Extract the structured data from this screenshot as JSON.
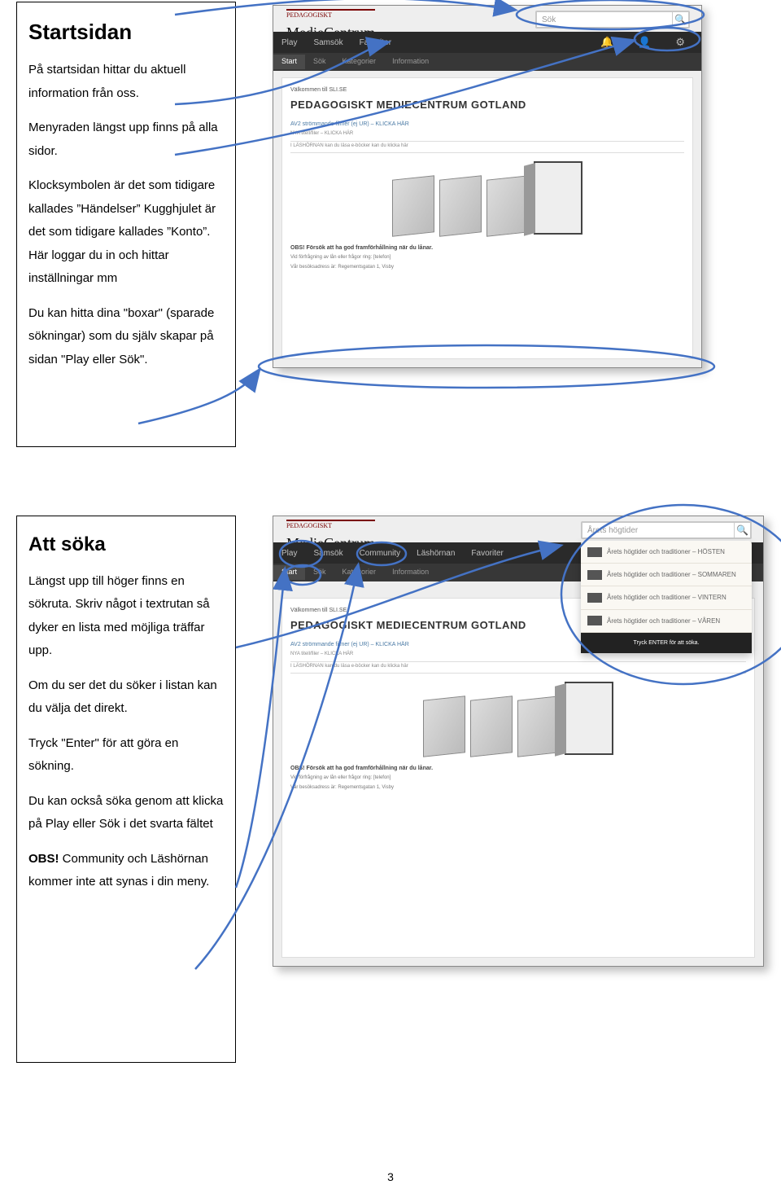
{
  "pageNumber": "3",
  "box1": {
    "title": "Startsidan",
    "p1": "På startsidan hittar du aktuell information från oss.",
    "p2": "Menyraden längst upp finns på alla sidor.",
    "p3": "Klocksymbolen är det som tidigare kallades ”Händelser” Kugghjulet är det som tidigare kallades ”Konto”. Här loggar du in och hittar inställningar mm",
    "p4": "Du kan hitta dina \"boxar\" (sparade sökningar) som du själv skapar på sidan \"Play eller Sök\"."
  },
  "box2": {
    "title": "Att söka",
    "p1": "Längst upp till höger finns en sökruta. Skriv något i textrutan så dyker en lista med möjliga träffar upp.",
    "p2": "Om du ser det du söker i listan kan du välja det direkt.",
    "p3": "Tryck \"Enter\" för att göra en sökning.",
    "p4": "Du kan också söka genom att klicka på Play eller Sök i det svarta fältet",
    "p5a": "OBS!",
    "p5b": " Community och Läshörnan kommer inte att synas i din meny."
  },
  "shot1": {
    "logo_brand": "PEDAGOGISKT",
    "logo_script": "MedieCentrum",
    "search_placeholder": "Sök",
    "nav": {
      "play": "Play",
      "samsok": "Samsök",
      "favoriter": "Favoriter"
    },
    "icon_bell": "🔔",
    "icon_user": "👤",
    "icon_gear": "⚙",
    "subnav": {
      "start": "Start",
      "sok": "Sök",
      "kategorier": "Kategorier",
      "info": "Information"
    },
    "welcome_small": "Välkommen till SLI.SE",
    "big": "PEDAGOGISKT MEDIECENTRUM GOTLAND",
    "link1": "AV2 strömmande filmer (ej UR) – KLICKA HÄR",
    "tiny1": "NYA titell/filer – KLICKA HÄR",
    "tiny2": "I LÄSHÖRNAN kan du läsa e-böcker kan du klicka här",
    "obs": "OBS! Försök att ha god framförhållning när du lånar.",
    "obssub": "Vid förfrågning av lån eller frågor ring: [telefon]",
    "addr": "Vår besöksadress är: Regementsgatan 1, Visby"
  },
  "shot2": {
    "logo_brand": "PEDAGOGISKT",
    "logo_script": "MedieCentrum",
    "search_value": "Årets högtider",
    "nav": {
      "play": "Play",
      "samsok": "Samsök",
      "community": "Community",
      "lashornan": "Läshörnan",
      "favoriter": "Favoriter"
    },
    "subnav": {
      "start": "Start",
      "sok": "Sök",
      "kategorier": "Kategorier",
      "info": "Information"
    },
    "welcome_small": "Välkommen till SLI.SE",
    "big": "PEDAGOGISKT MEDIECENTRUM GOTLAND",
    "link1": "AV2 strömmande filmer (ej UR) – KLICKA HÄR",
    "tiny1": "NYA titell/filer – KLICKA HÄR",
    "tiny2": "I LÄSHÖRNAN kan du läsa e-böcker kan du klicka här",
    "dropdown": {
      "r1": "Årets högtider och traditioner – HÖSTEN",
      "r2": "Årets högtider och traditioner – SOMMAREN",
      "r3": "Årets högtider och traditioner – VINTERN",
      "r4": "Årets högtider och traditioner – VÅREN",
      "btn": "Tryck ENTER för att söka."
    },
    "obs": "OBS! Försök att ha god framförhållning när du lånar.",
    "obssub": "Vid förfrågning av lån eller frågor ring: [telefon]",
    "addr": "Vår besöksadress är: Regementsgatan 1, Visby"
  }
}
